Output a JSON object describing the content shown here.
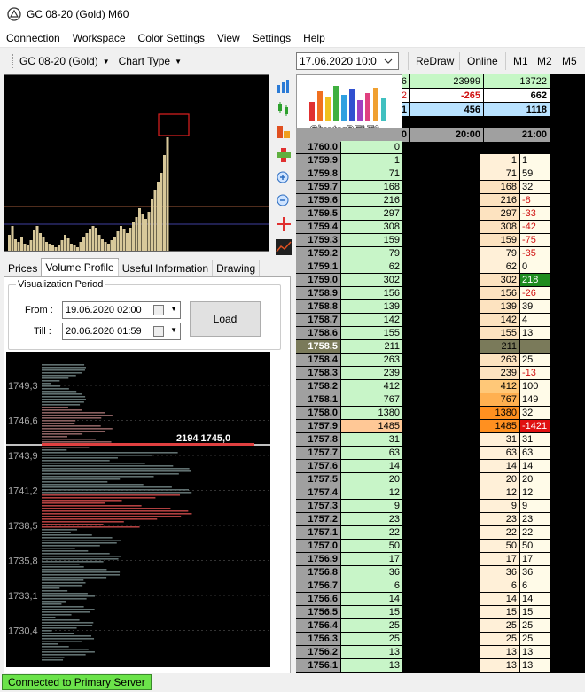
{
  "window": {
    "title": "GC 08-20 (Gold) M60"
  },
  "menu": [
    "Connection",
    "Workspace",
    "Color Settings",
    "View",
    "Settings",
    "Help"
  ],
  "toolbar": {
    "instrument": "GC 08-20 (Gold)",
    "chart_type": "Chart Type",
    "date": "17.06.2020 10:0",
    "redraw": "ReDraw",
    "online": "Online",
    "tf": [
      "M1",
      "M2",
      "M5"
    ]
  },
  "icons": {
    "sidebar": [
      "bar-chart-icon",
      "candles-icon",
      "cluster-icon",
      "cross-cluster-icon",
      "zoom-in-icon",
      "zoom-out-icon",
      "crosshair-icon",
      "chart-line-icon"
    ]
  },
  "tabs": [
    "Prices",
    "Volume Profile",
    "Useful Information",
    "Drawing"
  ],
  "active_tab": 1,
  "viz": {
    "legend": "Visualization Period",
    "from_label": "From :",
    "from_value": "19.06.2020 02:00",
    "till_label": "Till :",
    "till_value": "20.06.2020 01:59",
    "load": "Load"
  },
  "profile": {
    "yticks": [
      "1749,3",
      "1746,6",
      "1743,9",
      "1741,2",
      "1738,5",
      "1735,8",
      "1733,1",
      "1730,4"
    ],
    "poc_label": "2194  1745,0"
  },
  "logo": {
    "text": "ClusterDELTA"
  },
  "summary": {
    "rows": [
      [
        "6",
        "23999",
        "13722"
      ],
      [
        "2",
        "-265",
        "662"
      ],
      [
        "1",
        "456",
        "1118"
      ]
    ],
    "colors": [
      "#c6f7c6",
      "#ffffff",
      "#b9e2ff"
    ],
    "neg": [
      [
        false,
        false,
        false
      ],
      [
        true,
        true,
        false
      ],
      [
        false,
        false,
        false
      ]
    ]
  },
  "header": {
    "col1": "0",
    "col2": "20:00",
    "col3": "21:00"
  },
  "ladder": [
    {
      "p": "1760.0",
      "v": "0",
      "a": "",
      "b": ""
    },
    {
      "p": "1759.9",
      "v": "1",
      "a": "1",
      "b": "1"
    },
    {
      "p": "1759.8",
      "v": "71",
      "a": "71",
      "b": "59"
    },
    {
      "p": "1759.7",
      "v": "168",
      "a": "168",
      "b": "32"
    },
    {
      "p": "1759.6",
      "v": "216",
      "a": "216",
      "b": "-8"
    },
    {
      "p": "1759.5",
      "v": "297",
      "a": "297",
      "b": "-33"
    },
    {
      "p": "1759.4",
      "v": "308",
      "a": "308",
      "b": "-42"
    },
    {
      "p": "1759.3",
      "v": "159",
      "a": "159",
      "b": "-75"
    },
    {
      "p": "1759.2",
      "v": "79",
      "a": "79",
      "b": "-35"
    },
    {
      "p": "1759.1",
      "v": "62",
      "a": "62",
      "b": "0"
    },
    {
      "p": "1759.0",
      "v": "302",
      "a": "302",
      "b": "218"
    },
    {
      "p": "1758.9",
      "v": "156",
      "a": "156",
      "b": "-26"
    },
    {
      "p": "1758.8",
      "v": "139",
      "a": "139",
      "b": "39"
    },
    {
      "p": "1758.7",
      "v": "142",
      "a": "142",
      "b": "4"
    },
    {
      "p": "1758.6",
      "v": "155",
      "a": "155",
      "b": "13"
    },
    {
      "p": "1758.5",
      "v": "211",
      "a": "211",
      "b": ""
    },
    {
      "p": "1758.4",
      "v": "263",
      "a": "263",
      "b": "25"
    },
    {
      "p": "1758.3",
      "v": "239",
      "a": "239",
      "b": "-13"
    },
    {
      "p": "1758.2",
      "v": "412",
      "a": "412",
      "b": "100"
    },
    {
      "p": "1758.1",
      "v": "767",
      "a": "767",
      "b": "149"
    },
    {
      "p": "1758.0",
      "v": "1380",
      "a": "1380",
      "b": "32"
    },
    {
      "p": "1757.9",
      "v": "1485",
      "a": "1485",
      "b": "-1421"
    },
    {
      "p": "1757.8",
      "v": "31",
      "a": "31",
      "b": "31"
    },
    {
      "p": "1757.7",
      "v": "63",
      "a": "63",
      "b": "63"
    },
    {
      "p": "1757.6",
      "v": "14",
      "a": "14",
      "b": "14"
    },
    {
      "p": "1757.5",
      "v": "20",
      "a": "20",
      "b": "20"
    },
    {
      "p": "1757.4",
      "v": "12",
      "a": "12",
      "b": "12"
    },
    {
      "p": "1757.3",
      "v": "9",
      "a": "9",
      "b": "9"
    },
    {
      "p": "1757.2",
      "v": "23",
      "a": "23",
      "b": "23"
    },
    {
      "p": "1757.1",
      "v": "22",
      "a": "22",
      "b": "22"
    },
    {
      "p": "1757.0",
      "v": "50",
      "a": "50",
      "b": "50"
    },
    {
      "p": "1756.9",
      "v": "17",
      "a": "17",
      "b": "17"
    },
    {
      "p": "1756.8",
      "v": "36",
      "a": "36",
      "b": "36"
    },
    {
      "p": "1756.7",
      "v": "6",
      "a": "6",
      "b": "6"
    },
    {
      "p": "1756.6",
      "v": "14",
      "a": "14",
      "b": "14"
    },
    {
      "p": "1756.5",
      "v": "15",
      "a": "15",
      "b": "15"
    },
    {
      "p": "1756.4",
      "v": "25",
      "a": "25",
      "b": "25"
    },
    {
      "p": "1756.3",
      "v": "25",
      "a": "25",
      "b": "25"
    },
    {
      "p": "1756.2",
      "v": "13",
      "a": "13",
      "b": "13"
    },
    {
      "p": "1756.1",
      "v": "13",
      "a": "13",
      "b": "13"
    }
  ],
  "status": {
    "text": "Connected to Primary Server"
  },
  "colors": {
    "price_bg": "#a0a0a0",
    "vol_bg": "#c8f5c8",
    "poc": "#ffc896",
    "delta_pos_strong": "#1e8c1e",
    "delta_neg_strong": "#e01010",
    "neg_text": "#d01010",
    "current_price": "#7a7a5a"
  }
}
